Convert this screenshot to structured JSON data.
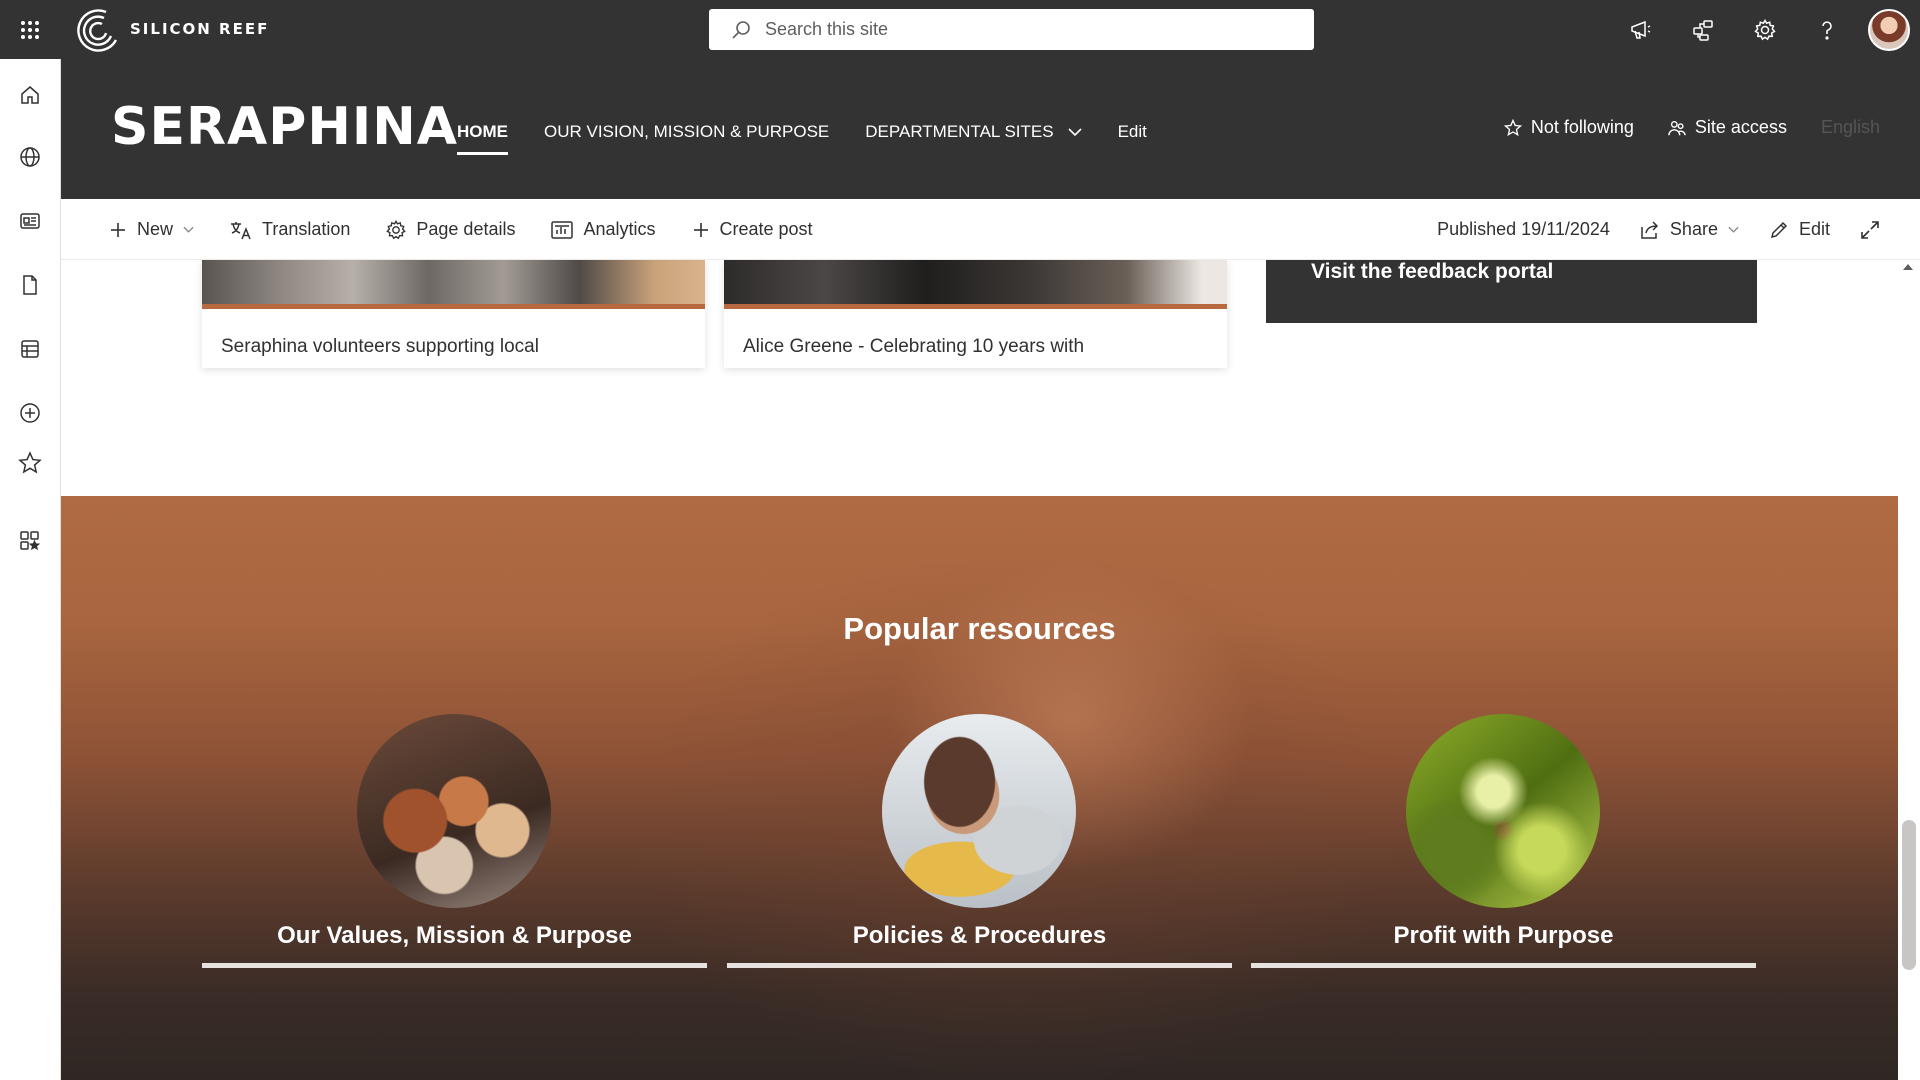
{
  "suite": {
    "brand": "SILICON REEF",
    "search_placeholder": "Search this site"
  },
  "site": {
    "title": "SERAPHINA",
    "nav": [
      {
        "label": "HOME"
      },
      {
        "label": "OUR VISION, MISSION & PURPOSE"
      },
      {
        "label": "DEPARTMENTAL SITES"
      },
      {
        "label": "Edit"
      }
    ],
    "not_following": "Not following",
    "site_access": "Site access",
    "language": "English"
  },
  "commandbar": {
    "new": "New",
    "translation": "Translation",
    "page_details": "Page details",
    "analytics": "Analytics",
    "create_post": "Create post",
    "published": "Published 19/11/2024",
    "share": "Share",
    "edit": "Edit"
  },
  "news": [
    {
      "title": "Seraphina volunteers supporting local"
    },
    {
      "title": "Alice Greene - Celebrating 10 years with"
    }
  ],
  "feedback": {
    "label": "Visit the feedback portal"
  },
  "popular": {
    "title": "Popular resources",
    "items": [
      {
        "label": "Our Values, Mission & Purpose"
      },
      {
        "label": "Policies & Procedures"
      },
      {
        "label": "Profit with Purpose"
      }
    ]
  },
  "colors": {
    "header_bg": "#333333",
    "accent": "#b9693f"
  }
}
